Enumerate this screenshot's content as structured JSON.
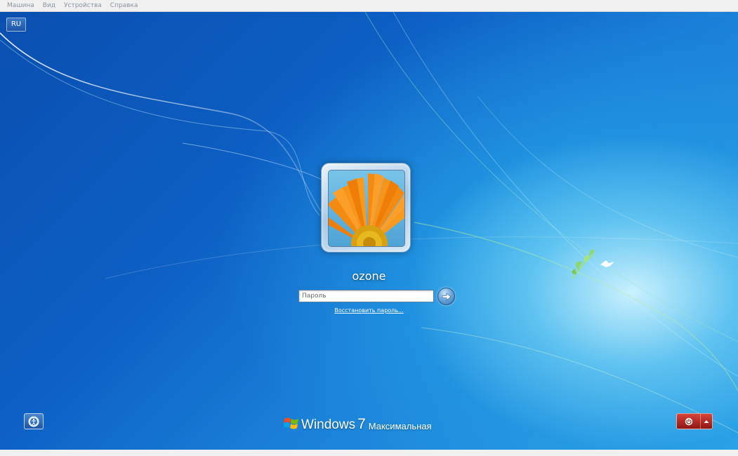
{
  "menubar": {
    "items": [
      {
        "label": "Машина"
      },
      {
        "label": "Вид"
      },
      {
        "label": "Устройства"
      },
      {
        "label": "Справка"
      }
    ]
  },
  "login": {
    "language": "RU",
    "username": "ozone",
    "password_placeholder": "Пароль",
    "password_value": "",
    "reset_link": "Восстановить пароль..."
  },
  "branding": {
    "product": "Windows",
    "version": "7",
    "edition": "Максимальная"
  },
  "icons": {
    "submit": "arrow-right-icon",
    "ease_of_access": "ease-of-access-icon",
    "power": "power-icon",
    "power_options": "chevron-up-icon",
    "avatar": "flower-icon",
    "windows_logo": "windows-flag-icon"
  },
  "colors": {
    "wallpaper_blue": "#0d5fc4",
    "power_red": "#b8261e"
  }
}
